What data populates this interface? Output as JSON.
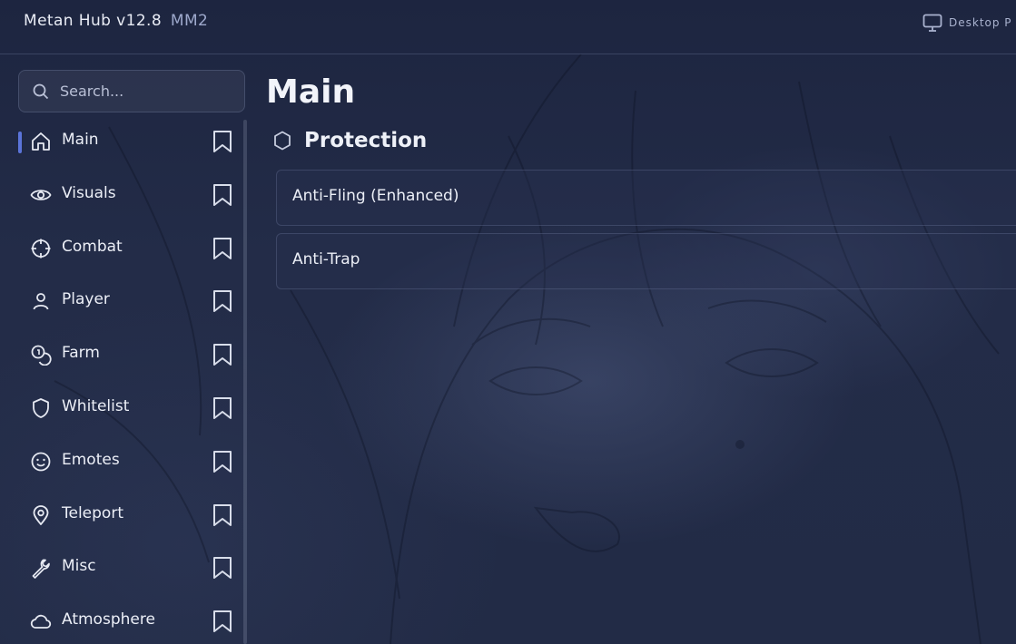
{
  "titlebar": {
    "title": "Metan Hub v12.8",
    "subtitle": "MM2",
    "device_label": "Desktop P"
  },
  "search": {
    "placeholder": "Search..."
  },
  "sidebar": {
    "items": [
      {
        "label": "Main",
        "icon": "home-icon",
        "active": true
      },
      {
        "label": "Visuals",
        "icon": "eye-icon",
        "active": false
      },
      {
        "label": "Combat",
        "icon": "crosshair-icon",
        "active": false
      },
      {
        "label": "Player",
        "icon": "user-icon",
        "active": false
      },
      {
        "label": "Farm",
        "icon": "coins-icon",
        "active": false
      },
      {
        "label": "Whitelist",
        "icon": "shield-icon",
        "active": false
      },
      {
        "label": "Emotes",
        "icon": "smile-icon",
        "active": false
      },
      {
        "label": "Teleport",
        "icon": "map-pin-icon",
        "active": false
      },
      {
        "label": "Misc",
        "icon": "wrench-icon",
        "active": false
      },
      {
        "label": "Atmosphere",
        "icon": "cloud-icon",
        "active": false
      }
    ]
  },
  "main": {
    "title": "Main",
    "section": {
      "title": "Protection",
      "icon": "hexagon-icon",
      "rows": [
        {
          "label": "Anti-Fling (Enhanced)"
        },
        {
          "label": "Anti-Trap"
        }
      ]
    }
  },
  "colors": {
    "accent": "#5b74d9",
    "background": "#222b46",
    "text": "#eceff7"
  }
}
